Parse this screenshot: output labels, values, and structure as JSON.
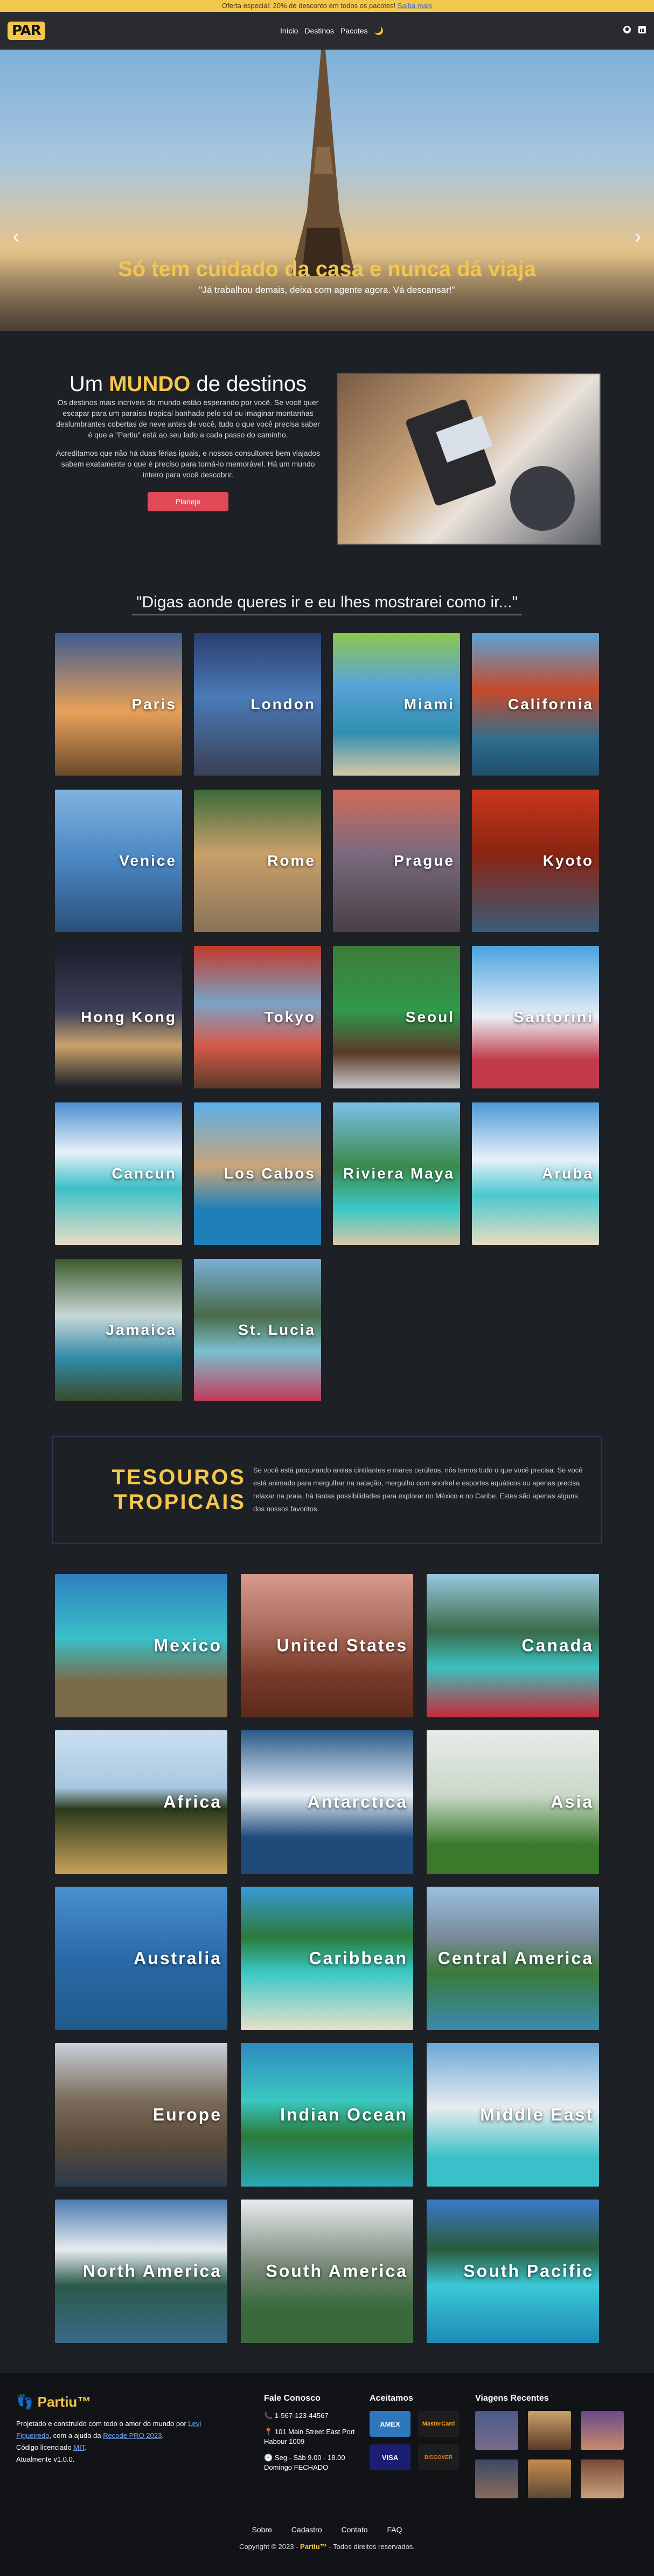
{
  "promo": {
    "text": "Oferta especial: 20% de desconto em todos os pacotes!",
    "link": "Saiba mais"
  },
  "nav": {
    "logo": "PAR",
    "links": [
      "Início",
      "Destinos",
      "Pacotes",
      "🌙"
    ],
    "icons": [
      "github-icon",
      "linkedin-icon"
    ]
  },
  "hero": {
    "title": "Só tem cuidado da casa e nunca dá viaja",
    "subtitle": "\"Já trabalhou demais, deixa com agente agora. Vá descansar!\""
  },
  "world": {
    "title_pre": "Um",
    "title_accent": "MUNDO",
    "title_post": "de destinos",
    "p1": "Os destinos mais incríveis do mundo estão esperando por você. Se você quer escapar para um paraíso tropical banhado pelo sol ou imaginar montanhas deslumbrantes cobertas de neve antes de você, tudo o que você precisa saber é que a \"Partiu\" está ao seu lado a cada passo do caminho.",
    "p2": "Acreditamos que não há duas férias iguais, e nossos consultores bem viajados sabem exatamente o que é preciso para torná-lo memorável. Há um mundo inteiro para você descobrir.",
    "button": "Planeje"
  },
  "quote": "\"Digas aonde queres ir e eu lhes mostrarei como ir...\"",
  "destinations": [
    {
      "name": "Paris",
      "bg": "linear-gradient(180deg,#3d5c8f,#e8a15a 55%,#6b4a2a)"
    },
    {
      "name": "London",
      "bg": "linear-gradient(180deg,#2a3e6e,#4b7ab8 45%,#3a3f55)"
    },
    {
      "name": "Miami",
      "bg": "linear-gradient(180deg,#8cc84b,#5aa4d8 35%,#2f8fb0 70%,#d6c9a7)"
    },
    {
      "name": "California",
      "bg": "linear-gradient(180deg,#5aa3d6,#c74a2a 40%,#2d6e8e 75%,#1f4e6b)"
    },
    {
      "name": "Venice",
      "bg": "linear-gradient(180deg,#7fb3e0,#4a86c2 50%,#2a4f7a)"
    },
    {
      "name": "Rome",
      "bg": "linear-gradient(180deg,#3c6a3a,#c9a06a 45%,#8a7358)"
    },
    {
      "name": "Prague",
      "bg": "linear-gradient(180deg,#d26a5a,#7a6a7e 45%,#4a3f46)"
    },
    {
      "name": "Kyoto",
      "bg": "linear-gradient(180deg,#c9361c,#8a2412 45%,#3a5c7a)"
    },
    {
      "name": "Hong Kong",
      "bg": "linear-gradient(180deg,#1c1e2a,#3c3f5a 45%,#c9a26a 70%,#1a1c28)"
    },
    {
      "name": "Tokyo",
      "bg": "linear-gradient(180deg,#c23a2a,#7aa3c8 40%,#d65a4a 70%,#5a3a2a)"
    },
    {
      "name": "Seoul",
      "bg": "linear-gradient(180deg,#3f7a3a,#2f9a4a 45%,#5a3a2a 75%,#c9c9c9)"
    },
    {
      "name": "Santorini",
      "bg": "linear-gradient(180deg,#4aa3e0,#e8eef5 50%,#c23a4a 80%)"
    },
    {
      "name": "Cancun",
      "bg": "linear-gradient(180deg,#4a8fd0,#e8f0f8 35%,#3ac0c8 60%,#e8dcc4)"
    },
    {
      "name": "Los Cabos",
      "bg": "linear-gradient(180deg,#5ab0e8,#c9a57a 45%,#1f7fb8 75%)"
    },
    {
      "name": "Riviera Maya",
      "bg": "linear-gradient(180deg,#7ac0e8,#3a8a4a 45%,#3ac8c8 75%,#d8c8a4)"
    },
    {
      "name": "Aruba",
      "bg": "linear-gradient(180deg,#4a9ad8,#e8f0f8 40%,#4ac8d0 65%,#e8dcc0)"
    },
    {
      "name": "Jamaica",
      "bg": "linear-gradient(180deg,#3a5a2a,#c9d8d8 40%,#2f8aa8 70%,#3a4a2a)"
    },
    {
      "name": "St. Lucia",
      "bg": "linear-gradient(180deg,#7ab0d8,#4a6a4a 40%,#7ac0d0 65%,#c23a5a)"
    }
  ],
  "tropical": {
    "title": "TESOUROS TROPICAIS",
    "text": "Se você está procurando areias cintilantes e mares cerúleos, nós temos tudo o que você precisa. Se você está animado para mergulhar na natação, mergulho com snorkel e esportes aquáticos ou apenas precisa relaxar na praia, há tantas possibilidades para explorar no México e no Caribe. Estes são apenas alguns dos nossos favoritos."
  },
  "regions": [
    {
      "name": "Mexico",
      "bg": "linear-gradient(180deg,#2f7fc0,#3ac0c8 45%,#7a6a4a 75%)"
    },
    {
      "name": "United States",
      "bg": "linear-gradient(180deg,#d89a8a,#a86a5a 40%,#7a3a2a 70%,#5a2a1a)"
    },
    {
      "name": "Canada",
      "bg": "linear-gradient(180deg,#9ac8e0,#3a6a4a 40%,#3ac0c0 65%,#c82a3a)"
    },
    {
      "name": "Africa",
      "bg": "linear-gradient(180deg,#c9dff0,#a8c8e0 40%,#2a3a1a 55%,#c9a25a)"
    },
    {
      "name": "Antarctica",
      "bg": "linear-gradient(180deg,#2a5a8a,#e8f0f8 45%,#1f4a7a 75%)"
    },
    {
      "name": "Asia",
      "bg": "linear-gradient(180deg,#e8ece8,#c9d8c8 45%,#3a7a2a 80%)"
    },
    {
      "name": "Australia",
      "bg": "linear-gradient(180deg,#4a8fd0,#2a6aa8 50%,#1f5a8a)"
    },
    {
      "name": "Caribbean",
      "bg": "linear-gradient(180deg,#3a9ad8,#2a7a3a 35%,#3ac8c8 60%,#e8e0c8)"
    },
    {
      "name": "Central America",
      "bg": "linear-gradient(180deg,#9ac0e0,#7a8a9a 35%,#3a7a3a 60%,#3a8ab0)"
    },
    {
      "name": "Europe",
      "bg": "linear-gradient(180deg,#c9d0dc,#7a6a5a 40%,#5a4a3a 70%,#2a3a4a)"
    },
    {
      "name": "Indian Ocean",
      "bg": "linear-gradient(180deg,#2f8ac0,#3ac8c0 40%,#2a7a3a 65%,#2aa8b8)"
    },
    {
      "name": "Middle East",
      "bg": "linear-gradient(180deg,#6aa8d8,#e8ecf0 45%,#3ac0c8 80%)"
    },
    {
      "name": "North America",
      "bg": "linear-gradient(180deg,#4a7ab0,#e8ecf0 35%,#2a5a4a 60%,#3a6a8a)"
    },
    {
      "name": "South America",
      "bg": "linear-gradient(180deg,#e8ecf0,#7a8a7a 45%,#3a6a3a 75%)"
    },
    {
      "name": "South Pacific",
      "bg": "linear-gradient(180deg,#3a7ac8,#2a5a3a 35%,#3ac8d8 60%,#1f8ab8)"
    }
  ],
  "footer": {
    "brand": "Partiu™",
    "line1_pre": "Projetado e construído com todo o amor do mundo por",
    "author": "Levi Figueiredo",
    "line1_mid": ", com a ajuda da",
    "course": "Recode PRO 2023",
    "line1_end": ".",
    "license_pre": "Código licenciado",
    "license": "MIT",
    "version": "Atualmente v1.0.0.",
    "contact_title": "Fale Conosco",
    "phone": "1-567-123-44567",
    "address": "101 Main Street East Port Habour 1009",
    "hours": "Seg - Sáb 9.00 - 18.00 Domingo FECHADO",
    "payments_title": "Aceitamos",
    "payments": [
      "AMEX",
      "MasterCard",
      "VISA",
      "DISCOVER"
    ],
    "recent_title": "Viagens Recentes",
    "links": [
      "Sobre",
      "Cadastro",
      "Contato",
      "FAQ"
    ],
    "copy_pre": "Copyright © 2023 -",
    "copy_brand": "Partiu™",
    "copy_post": "- Todos direitos reservados."
  }
}
